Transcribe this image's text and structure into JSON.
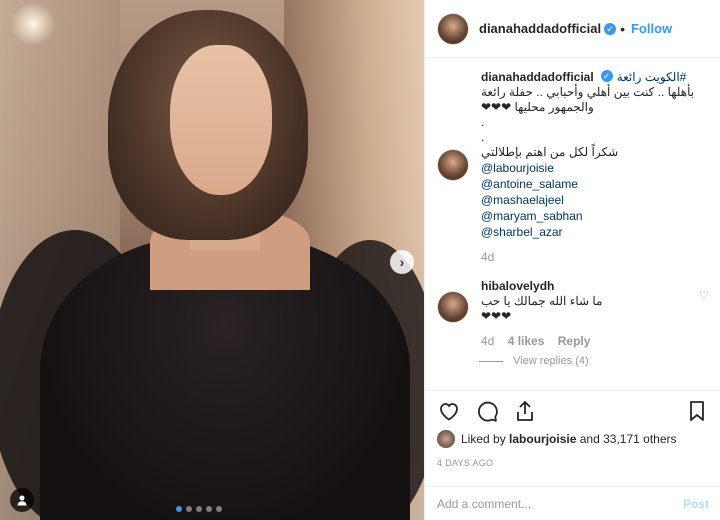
{
  "post": {
    "username": "dianahaddadofficial",
    "follow_label": "Follow",
    "dot": "•",
    "verified_glyph": "✓"
  },
  "caption": {
    "username": "dianahaddadofficial",
    "line1": "#الكويت رائعة",
    "line2": "بأهلها .. كنت بين أهلي وأحبابي .. حفلة رائعة",
    "line3": "والجمهور محليها ❤❤❤",
    "line4": ".",
    "line5": ".",
    "line6": "شكراً لكل من اهتم بإطلالتي",
    "mentions": [
      "@labourjoisie",
      "@antoine_salame",
      "@mashaelajeel",
      "@maryam_sabhan",
      "@sharbel_azar"
    ],
    "age": "4d"
  },
  "comment": {
    "username": "hibalovelydh",
    "text": "ما شاء الله جمالك يا حب",
    "emoji": "❤❤❤",
    "age": "4d",
    "likes": "4 likes",
    "reply_label": "Reply",
    "view_replies": "View replies (4)"
  },
  "likes": {
    "prefix": "Liked by",
    "liker": "labourjoisie",
    "suffix": "and 33,171 others"
  },
  "timestamp": "4 DAYS AGO",
  "add_comment": {
    "placeholder": "Add a comment...",
    "post_label": "Post"
  },
  "carousel": {
    "slide_count": 5,
    "active_index": 0,
    "next_glyph": "›"
  },
  "colors": {
    "accent": "#3897f0",
    "mention": "#003569",
    "muted": "#999999"
  }
}
